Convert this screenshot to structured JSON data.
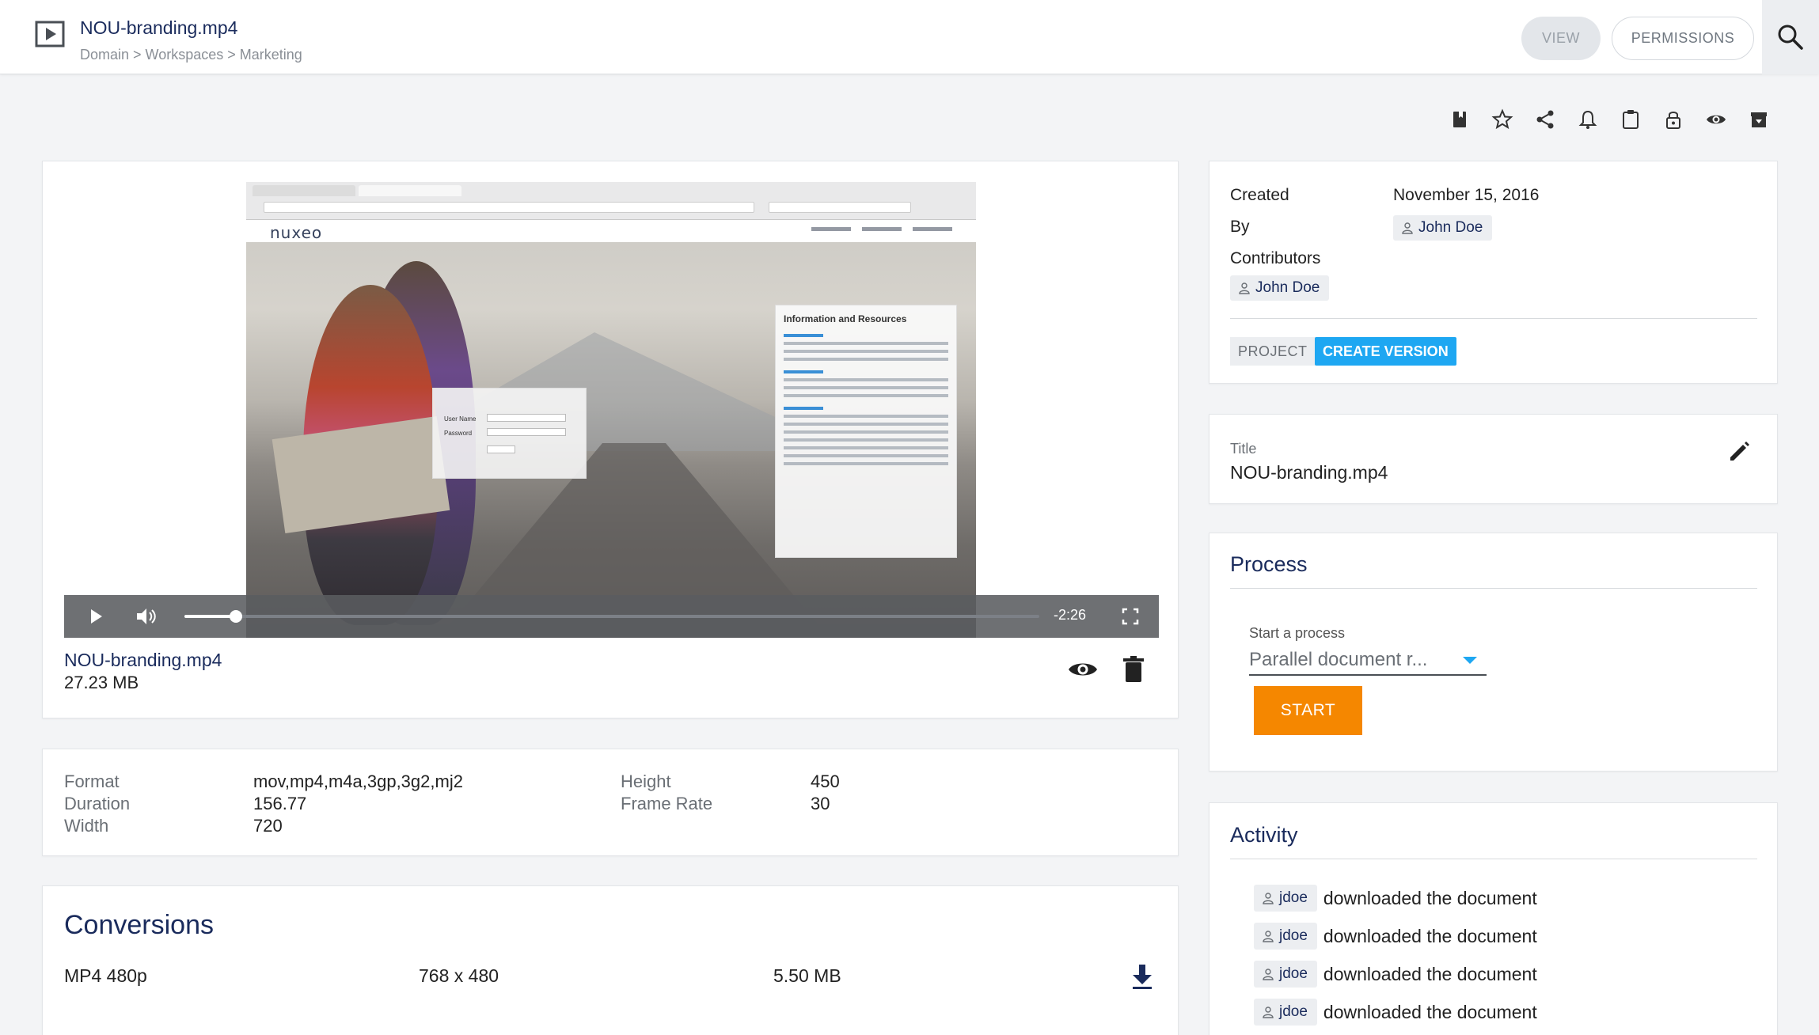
{
  "header": {
    "title": "NOU-branding.mp4",
    "breadcrumb": "Domain > Workspaces > Marketing",
    "view_label": "VIEW",
    "permissions_label": "PERMISSIONS"
  },
  "actions": [
    "bookmark-icon",
    "star-icon",
    "share-icon",
    "bell-icon",
    "clipboard-icon",
    "lock-icon",
    "eye-icon",
    "archive-icon"
  ],
  "video": {
    "time_remaining": "-2:26",
    "progress": 0.06,
    "site_logo": "nuxeo",
    "login_user_label": "User Name",
    "login_pass_label": "Password",
    "info_heading": "Information and Resources"
  },
  "file": {
    "name": "NOU-branding.mp4",
    "size": "27.23 MB"
  },
  "info": {
    "format_label": "Format",
    "format_value": "mov,mp4,m4a,3gp,3g2,mj2",
    "duration_label": "Duration",
    "duration_value": "156.77",
    "width_label": "Width",
    "width_value": "720",
    "height_label": "Height",
    "height_value": "450",
    "frame_rate_label": "Frame Rate",
    "frame_rate_value": "30"
  },
  "conversions": {
    "title": "Conversions",
    "rows": [
      {
        "name": "MP4 480p",
        "dimensions": "768 x 480",
        "size": "5.50 MB"
      }
    ]
  },
  "meta": {
    "created_label": "Created",
    "created_value": "November 15, 2016",
    "by_label": "By",
    "by_user": "John Doe",
    "contributors_label": "Contributors",
    "contributor_user": "John Doe",
    "state_tag": "PROJECT",
    "create_version_label": "CREATE VERSION"
  },
  "title_card": {
    "label": "Title",
    "value": "NOU-branding.mp4"
  },
  "process": {
    "title": "Process",
    "start_label": "Start a process",
    "selected": "Parallel document r...",
    "start_button": "START"
  },
  "activity": {
    "title": "Activity",
    "items": [
      {
        "user": "jdoe",
        "text": "downloaded the document"
      },
      {
        "user": "jdoe",
        "text": "downloaded the document"
      },
      {
        "user": "jdoe",
        "text": "downloaded the document"
      },
      {
        "user": "jdoe",
        "text": "downloaded the document"
      }
    ]
  },
  "colors": {
    "accent_blue": "#1ea7f2",
    "title_navy": "#1a2b5c",
    "start_orange": "#f58700"
  }
}
